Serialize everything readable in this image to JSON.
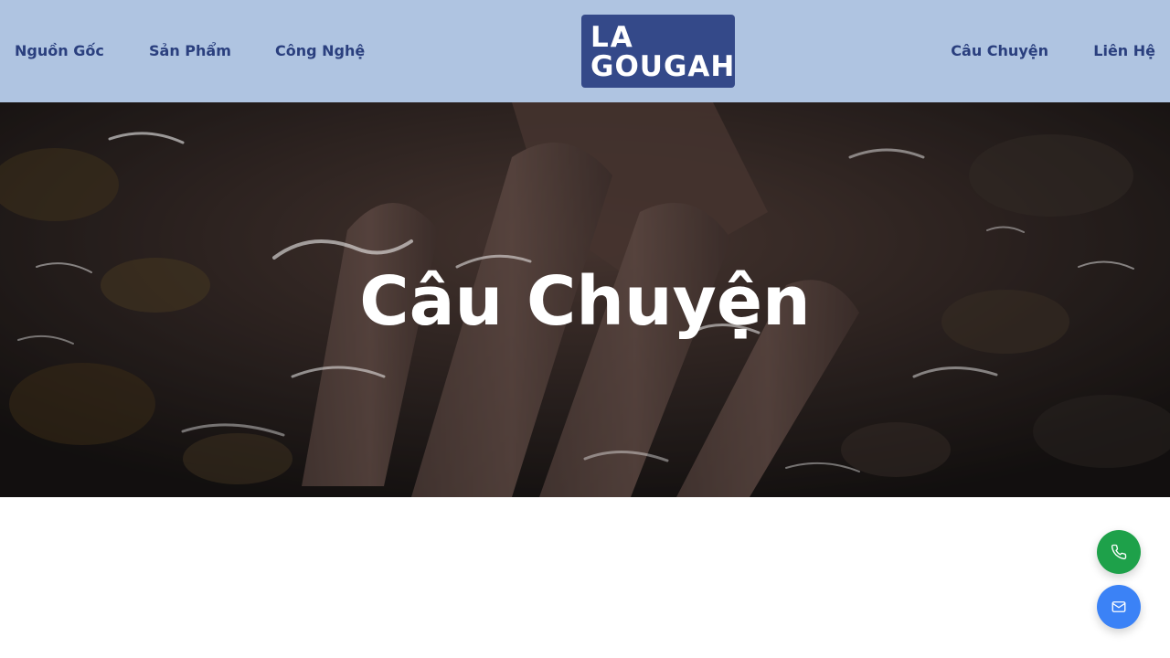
{
  "header": {
    "nav_left": [
      "Nguồn Gốc",
      "Sản Phẩm",
      "Công Nghệ"
    ],
    "nav_right": [
      "Câu Chuyện",
      "Liên Hệ"
    ],
    "logo": {
      "line1": "LA",
      "line2": "GOUGAH"
    }
  },
  "hero": {
    "title": "Câu Chuyện",
    "image": "hand-in-clear-stream-water"
  },
  "floating_actions": [
    {
      "icon": "phone-icon",
      "color": "#1ea14a"
    },
    {
      "icon": "mail-icon",
      "color": "#3b82f6"
    }
  ],
  "colors": {
    "header_bg": "#afc4e1",
    "nav_text": "#2a3f7e",
    "logo_bg": "#344989"
  }
}
